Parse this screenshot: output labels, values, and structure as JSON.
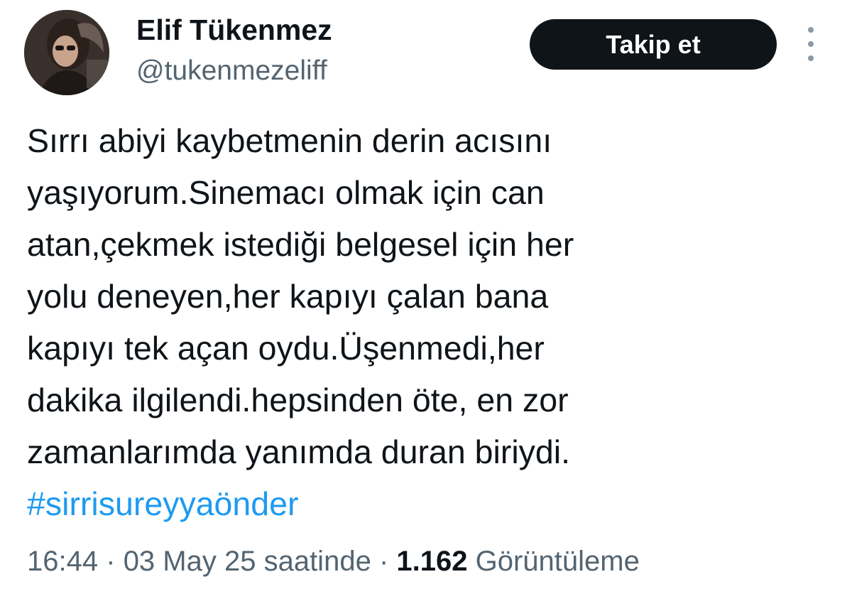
{
  "author": {
    "display_name": "Elif Tükenmez",
    "handle": "@tukenmezeliff"
  },
  "follow_button": {
    "label": "Takip et"
  },
  "tweet": {
    "lines": [
      "Sırrı abiyi  kaybetmenin derin acısını",
      "yaşıyorum.Sinemacı olmak için can",
      "atan,çekmek istediği belgesel için her",
      "yolu deneyen,her kapıyı çalan bana",
      "kapıyı tek açan oydu.Üşenmedi,her",
      "dakika ilgilendi.hepsinden öte, en zor",
      "zamanlarımda yanımda duran biriydi."
    ],
    "hashtag": "#sirrisureyyaönder"
  },
  "meta": {
    "time": "16:44",
    "separator": "·",
    "date": "03 May 25 saatinde",
    "views_count": "1.162",
    "views_label": "Görüntüleme"
  },
  "colors": {
    "primary_text": "#0f1419",
    "secondary_text": "#536471",
    "link": "#1d9bf0",
    "button_bg": "#0f1419",
    "button_text": "#ffffff"
  },
  "icons": {
    "more": "more-vertical-icon"
  }
}
